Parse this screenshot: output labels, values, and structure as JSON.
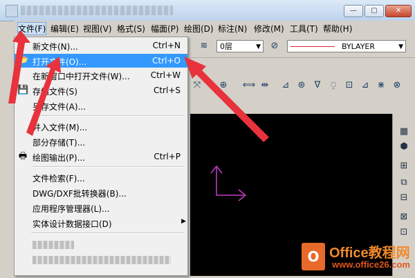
{
  "menubar": {
    "items": [
      "文件(F)",
      "编辑(E)",
      "视图(V)",
      "格式(S)",
      "幅面(P)",
      "绘图(D)",
      "标注(N)",
      "修改(M)",
      "工具(T)",
      "帮助(H)"
    ]
  },
  "toolbar": {
    "layer_value": "0层",
    "linetype_value": "BYLAYER"
  },
  "file_menu": {
    "items": [
      {
        "label": "新文件(N)...",
        "shortcut": "Ctrl+N",
        "icon": "new-file-icon"
      },
      {
        "label": "打开文件(O)...",
        "shortcut": "Ctrl+O",
        "icon": "open-folder-icon",
        "highlighted": true
      },
      {
        "label": "在新窗口中打开文件(W)...",
        "shortcut": "Ctrl+W",
        "icon": ""
      },
      {
        "label": "存储文件(S)",
        "shortcut": "Ctrl+S",
        "icon": "save-disk-icon"
      },
      {
        "label": "另存文件(A)...",
        "shortcut": "",
        "icon": ""
      },
      {
        "label": "并入文件(M)...",
        "shortcut": "",
        "icon": ""
      },
      {
        "label": "部分存储(T)...",
        "shortcut": "",
        "icon": ""
      },
      {
        "label": "绘图输出(P)...",
        "shortcut": "Ctrl+P",
        "icon": "printer-icon"
      },
      {
        "label": "文件检索(F)...",
        "shortcut": "",
        "icon": ""
      },
      {
        "label": "DWG/DXF批转换器(B)...",
        "shortcut": "",
        "icon": ""
      },
      {
        "label": "应用程序管理器(L)...",
        "shortcut": "",
        "icon": ""
      },
      {
        "label": "实体设计数据接口(D)",
        "shortcut": "",
        "icon": "",
        "submenu": true
      }
    ]
  },
  "watermark": {
    "logo": "O",
    "title": "Office教程网",
    "url": "www.office26.com"
  },
  "colors": {
    "highlight": "#3399ff",
    "annotation_arrow": "#e8323c",
    "canvas_axis": "#c83cc8",
    "watermark_orange": "#f08a2a"
  }
}
